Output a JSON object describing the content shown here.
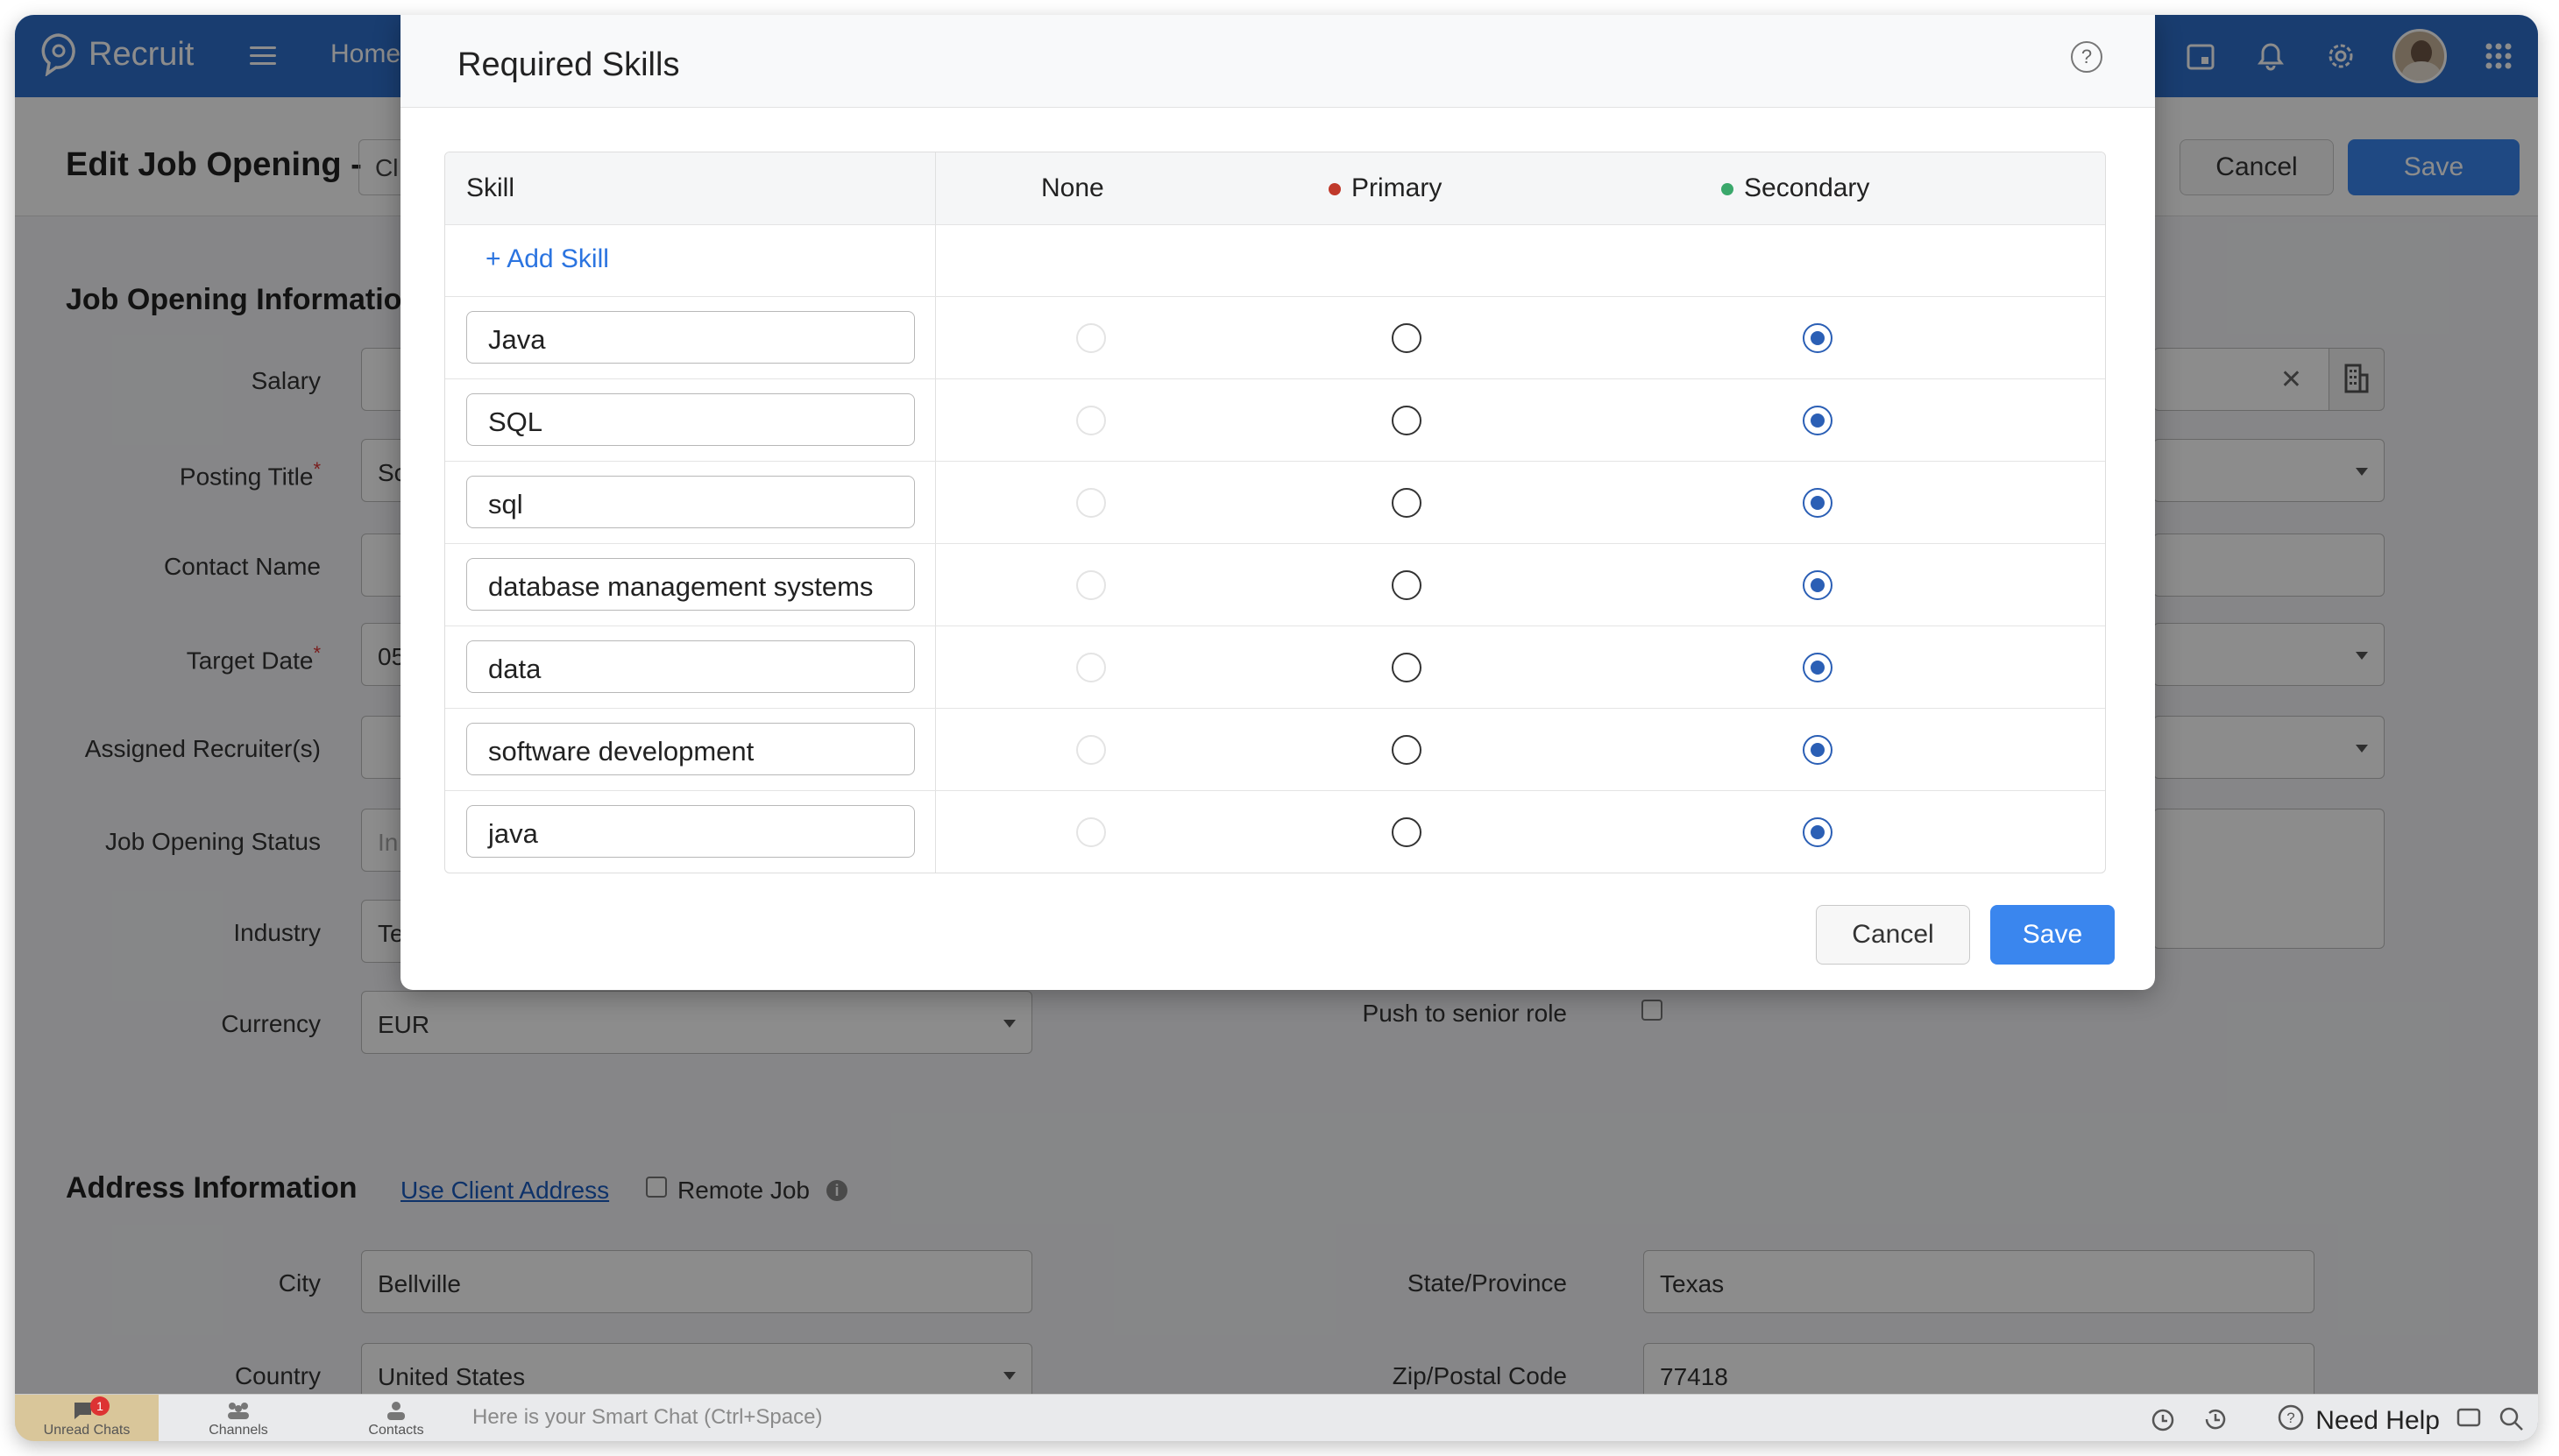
{
  "app": {
    "brand": "Recruit",
    "nav_home": "Home"
  },
  "page": {
    "title": "Edit Job Opening -",
    "title_value": "Cl",
    "cancel_label": "Cancel",
    "save_label": "Save"
  },
  "section_job": "Job Opening Informatio",
  "fields": {
    "salary": "Salary",
    "posting_title": "Posting Title",
    "posting_title_value": "Sc",
    "contact_name": "Contact Name",
    "target_date": "Target Date",
    "target_date_value": "05",
    "assigned_recruiters": "Assigned Recruiter(s)",
    "job_opening_status": "Job Opening Status",
    "job_opening_status_value": "In",
    "industry": "Industry",
    "industry_value": "Te",
    "currency": "Currency",
    "currency_value": "EUR",
    "push_senior": "Push to senior role"
  },
  "address": {
    "title": "Address Information",
    "use_client": "Use Client Address",
    "remote_job": "Remote Job",
    "city_label": "City",
    "city_value": "Bellville",
    "state_label": "State/Province",
    "state_value": "Texas",
    "country_label": "Country",
    "country_value": "United States",
    "zip_label": "Zip/Postal Code",
    "zip_value": "77418"
  },
  "modal": {
    "title": "Required Skills",
    "col_skill": "Skill",
    "col_none": "None",
    "col_primary": "Primary",
    "col_secondary": "Secondary",
    "add_skill": "+ Add Skill",
    "primary_color": "#c0392b",
    "secondary_color": "#3aa86b",
    "skills": [
      {
        "name": "Java",
        "level": "Secondary"
      },
      {
        "name": "SQL",
        "level": "Secondary"
      },
      {
        "name": "sql",
        "level": "Secondary"
      },
      {
        "name": "database management systems",
        "level": "Secondary"
      },
      {
        "name": "data",
        "level": "Secondary"
      },
      {
        "name": "software development",
        "level": "Secondary"
      },
      {
        "name": "java",
        "level": "Secondary"
      }
    ],
    "cancel_label": "Cancel",
    "save_label": "Save"
  },
  "bottombar": {
    "unread_chats": "Unread Chats",
    "unread_count": "1",
    "channels": "Channels",
    "contacts": "Contacts",
    "chat_placeholder": "Here is your Smart Chat (Ctrl+Space)",
    "need_help": "Need Help"
  },
  "icons": [
    "help-circle-icon",
    "menu-icon",
    "calendar-icon",
    "bell-icon",
    "gear-icon",
    "apps-grid-icon",
    "clear-x-icon",
    "building-icon",
    "alarm-icon",
    "history-icon",
    "question-icon",
    "feedback-icon",
    "search-icon",
    "info-icon",
    "chat-bubble-icon",
    "channels-icon",
    "contacts-icon"
  ]
}
